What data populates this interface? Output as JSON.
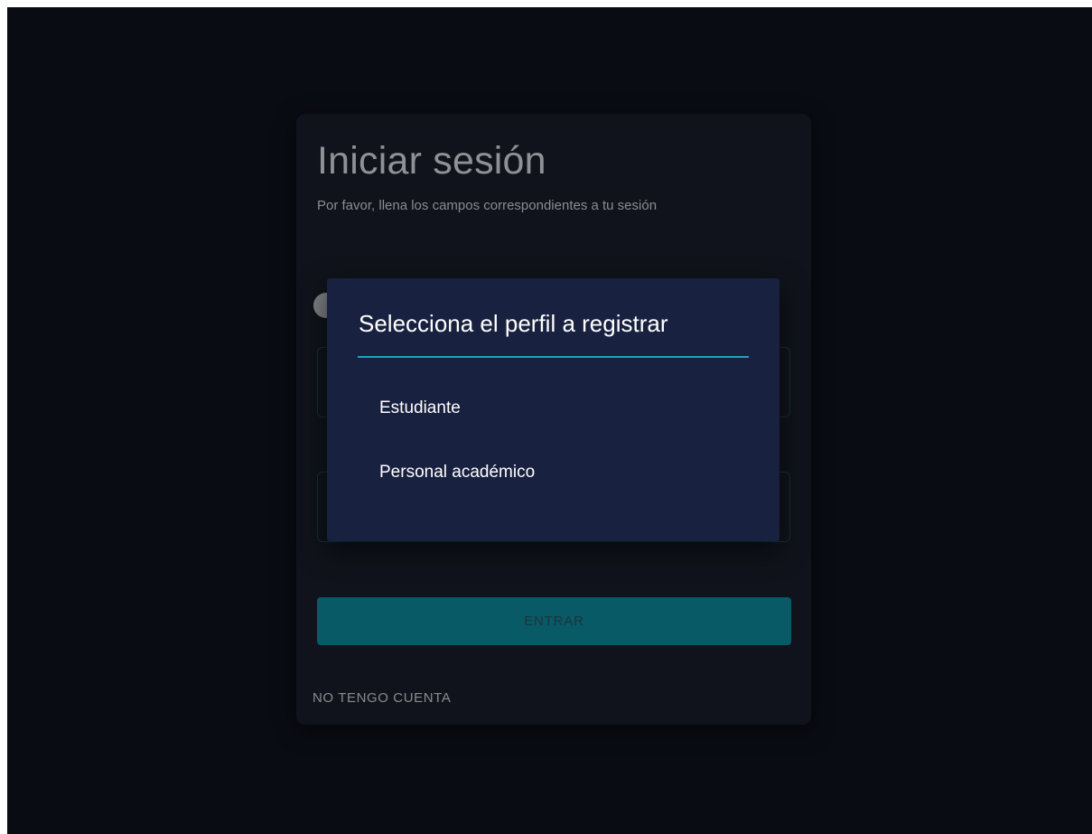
{
  "login": {
    "title": "Iniciar sesión",
    "subtitle": "Por favor, llena los campos correspondientes a tu sesión",
    "enter_label": "ENTRAR",
    "no_account_label": "NO TENGO CUENTA"
  },
  "dialog": {
    "title": "Selecciona el perfil a registrar",
    "options": [
      {
        "label": "Estudiante"
      },
      {
        "label": "Personal académico"
      }
    ]
  },
  "colors": {
    "background": "#0a0c13",
    "card": "#10131b",
    "dialog": "#18213f",
    "accent": "#1fa2c0",
    "button": "#075a66"
  }
}
